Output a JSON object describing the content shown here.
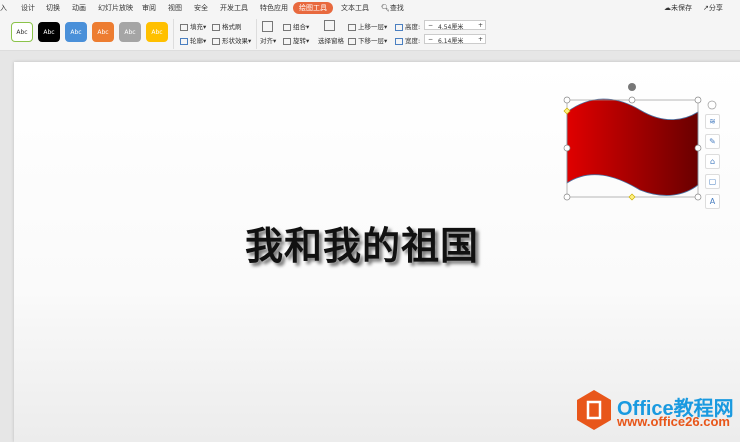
{
  "tabs": [
    "入",
    "设计",
    "切换",
    "动画",
    "幻灯片放映",
    "审阅",
    "视图",
    "安全",
    "开发工具",
    "特色应用",
    "绘图工具",
    "文本工具"
  ],
  "search": "查找",
  "right": {
    "unsaved": "未保存",
    "share": "分享"
  },
  "styles": [
    {
      "label": "Abc",
      "bg": "#ffffff",
      "fg": "#333333",
      "border": "#8bc34a"
    },
    {
      "label": "Abc",
      "bg": "#000000",
      "fg": "#ffffff",
      "border": "#000000"
    },
    {
      "label": "Abc",
      "bg": "#4a90d9",
      "fg": "#ffffff",
      "border": "#4a90d9"
    },
    {
      "label": "Abc",
      "bg": "#ed7d31",
      "fg": "#ffffff",
      "border": "#ed7d31"
    },
    {
      "label": "Abc",
      "bg": "#a5a5a5",
      "fg": "#ffffff",
      "border": "#a5a5a5"
    },
    {
      "label": "Abc",
      "bg": "#ffc000",
      "fg": "#ffffff",
      "border": "#ffc000"
    }
  ],
  "ribbon": {
    "fill": "填充",
    "format_painter": "格式刷",
    "outline": "轮廓",
    "shape_effect": "形状效果",
    "align": "对齐",
    "group": "组合",
    "rotate": "旋转",
    "selection_pane": "选择窗格",
    "bring_forward": "上移一层",
    "send_backward": "下移一层",
    "height_label": "高度:",
    "height_value": "4.54厘米",
    "width_label": "宽度:",
    "width_value": "6.14厘米",
    "minus": "−",
    "plus": "+"
  },
  "slide": {
    "title": "我和我的祖国"
  },
  "flag": {
    "color_start": "#e00000",
    "color_end": "#6a0000"
  },
  "watermark": {
    "line1": "Office教程网",
    "line2": "www.office26.com"
  }
}
